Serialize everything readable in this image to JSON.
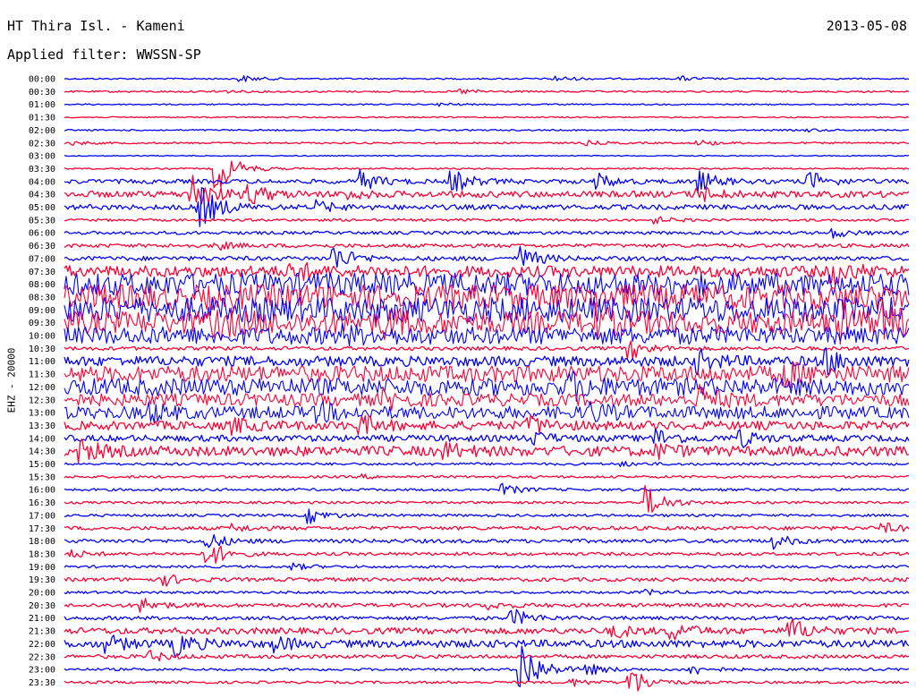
{
  "header": {
    "station": "HT Thira Isl. - Kameni",
    "date": "2013-05-08",
    "filter": "Applied filter: WWSSN-SP"
  },
  "chart_data": {
    "type": "line",
    "title": "HT Thira Isl. - Kameni",
    "subtitle": "Applied filter: WWSSN-SP",
    "ylabel": "EHZ - 20000",
    "xlabel": "",
    "grid": false,
    "trace_colors": [
      "#0000ff",
      "#ff0033"
    ],
    "rows": [
      {
        "label": "00:00",
        "noise": 0.12,
        "events": [
          [
            0.21,
            0.5
          ],
          [
            0.58,
            0.45
          ],
          [
            0.73,
            0.35
          ]
        ]
      },
      {
        "label": "00:30",
        "noise": 0.14,
        "events": [
          [
            0.47,
            0.4
          ],
          [
            0.18,
            0.25
          ]
        ]
      },
      {
        "label": "01:00",
        "noise": 0.1,
        "events": [
          [
            0.44,
            0.3
          ]
        ]
      },
      {
        "label": "01:30",
        "noise": 0.1,
        "events": []
      },
      {
        "label": "02:00",
        "noise": 0.12,
        "events": [
          [
            0.88,
            0.2
          ]
        ]
      },
      {
        "label": "02:30",
        "noise": 0.14,
        "events": [
          [
            0.75,
            0.5
          ],
          [
            0.01,
            0.3
          ],
          [
            0.62,
            0.3
          ]
        ]
      },
      {
        "label": "03:00",
        "noise": 0.08,
        "events": []
      },
      {
        "label": "03:30",
        "noise": 0.12,
        "events": [
          [
            0.18,
            4.0
          ]
        ]
      },
      {
        "label": "04:00",
        "noise": 0.35,
        "events": [
          [
            0.35,
            1.6
          ],
          [
            0.46,
            1.7
          ],
          [
            0.63,
            1.2
          ],
          [
            0.75,
            1.7
          ],
          [
            0.88,
            1.7
          ]
        ]
      },
      {
        "label": "04:30",
        "noise": 0.5,
        "events": [
          [
            0.15,
            3.5
          ],
          [
            0.22,
            1.4
          ],
          [
            0.75,
            1.3
          ],
          [
            0.33,
            0.8
          ]
        ]
      },
      {
        "label": "05:00",
        "noise": 0.4,
        "events": [
          [
            0.16,
            3.5
          ],
          [
            0.3,
            0.8
          ]
        ]
      },
      {
        "label": "05:30",
        "noise": 0.2,
        "events": [
          [
            0.7,
            0.5
          ]
        ]
      },
      {
        "label": "06:00",
        "noise": 0.25,
        "events": [
          [
            0.91,
            0.7
          ]
        ]
      },
      {
        "label": "06:30",
        "noise": 0.3,
        "events": [
          [
            0.18,
            0.6
          ]
        ]
      },
      {
        "label": "07:00",
        "noise": 0.35,
        "events": [
          [
            0.32,
            2.0
          ],
          [
            0.54,
            1.8
          ]
        ]
      },
      {
        "label": "07:30",
        "noise": 0.9,
        "events": [
          [
            0.91,
            1.6
          ],
          [
            0.27,
            1.4
          ]
        ]
      },
      {
        "label": "08:00",
        "noise": 1.8,
        "events": []
      },
      {
        "label": "08:30",
        "noise": 2.0,
        "events": []
      },
      {
        "label": "09:00",
        "noise": 2.0,
        "events": []
      },
      {
        "label": "09:30",
        "noise": 1.8,
        "events": [
          [
            0.18,
            1.5
          ],
          [
            0.38,
            1.5
          ],
          [
            0.63,
            1.5
          ],
          [
            0.92,
            1.8
          ],
          [
            0.97,
            1.8
          ]
        ]
      },
      {
        "label": "10:00",
        "noise": 1.4,
        "events": [
          [
            0.33,
            0.8
          ]
        ]
      },
      {
        "label": "10:30",
        "noise": 0.3,
        "events": [
          [
            0.67,
            1.6
          ]
        ]
      },
      {
        "label": "11:00",
        "noise": 0.8,
        "events": [
          [
            0.75,
            1.5
          ],
          [
            0.9,
            1.8
          ]
        ]
      },
      {
        "label": "11:30",
        "noise": 1.3,
        "events": [
          [
            0.85,
            1.8
          ]
        ]
      },
      {
        "label": "12:00",
        "noise": 1.4,
        "events": [
          [
            0.6,
            1.6
          ]
        ]
      },
      {
        "label": "12:30",
        "noise": 1.0,
        "events": [
          [
            0.75,
            2.0
          ],
          [
            0.38,
            1.0
          ]
        ]
      },
      {
        "label": "13:00",
        "noise": 1.0,
        "events": [
          [
            0.1,
            1.2
          ],
          [
            0.3,
            1.2
          ],
          [
            0.62,
            1.4
          ]
        ]
      },
      {
        "label": "13:30",
        "noise": 0.7,
        "events": [
          [
            0.35,
            1.4
          ],
          [
            0.55,
            1.4
          ],
          [
            0.2,
            1.0
          ]
        ]
      },
      {
        "label": "14:00",
        "noise": 0.5,
        "events": [
          [
            0.55,
            1.2
          ],
          [
            0.7,
            1.4
          ],
          [
            0.8,
            1.2
          ]
        ]
      },
      {
        "label": "14:30",
        "noise": 0.8,
        "events": [
          [
            0.02,
            1.4
          ],
          [
            0.45,
            1.0
          ],
          [
            0.7,
            1.0
          ]
        ]
      },
      {
        "label": "15:00",
        "noise": 0.2,
        "events": [
          [
            0.66,
            0.3
          ]
        ]
      },
      {
        "label": "15:30",
        "noise": 0.2,
        "events": [
          [
            0.35,
            0.3
          ]
        ]
      },
      {
        "label": "16:00",
        "noise": 0.2,
        "events": [
          [
            0.52,
            0.8
          ]
        ]
      },
      {
        "label": "16:30",
        "noise": 0.2,
        "events": [
          [
            0.69,
            2.6
          ]
        ]
      },
      {
        "label": "17:00",
        "noise": 0.2,
        "events": [
          [
            0.29,
            1.2
          ]
        ]
      },
      {
        "label": "17:30",
        "noise": 0.3,
        "events": [
          [
            0.2,
            0.5
          ],
          [
            0.97,
            0.7
          ]
        ]
      },
      {
        "label": "18:00",
        "noise": 0.3,
        "events": [
          [
            0.84,
            1.0
          ],
          [
            0.17,
            1.2
          ]
        ]
      },
      {
        "label": "18:30",
        "noise": 0.25,
        "events": [
          [
            0.17,
            2.2
          ],
          [
            0.01,
            0.5
          ]
        ]
      },
      {
        "label": "19:00",
        "noise": 0.2,
        "events": [
          [
            0.27,
            0.5
          ]
        ]
      },
      {
        "label": "19:30",
        "noise": 0.3,
        "events": [
          [
            0.12,
            0.8
          ]
        ]
      },
      {
        "label": "20:00",
        "noise": 0.2,
        "events": [
          [
            0.69,
            0.4
          ]
        ]
      },
      {
        "label": "20:30",
        "noise": 0.3,
        "events": [
          [
            0.09,
            1.2
          ],
          [
            0.5,
            0.6
          ]
        ]
      },
      {
        "label": "21:00",
        "noise": 0.3,
        "events": [
          [
            0.53,
            1.4
          ]
        ]
      },
      {
        "label": "21:30",
        "noise": 0.5,
        "events": [
          [
            0.72,
            1.3
          ],
          [
            0.86,
            1.8
          ],
          [
            0.65,
            1.0
          ]
        ]
      },
      {
        "label": "22:00",
        "noise": 0.6,
        "events": [
          [
            0.13,
            1.8
          ],
          [
            0.05,
            1.2
          ],
          [
            0.25,
            1.0
          ]
        ]
      },
      {
        "label": "22:30",
        "noise": 0.3,
        "events": [
          [
            0.1,
            0.8
          ]
        ]
      },
      {
        "label": "23:00",
        "noise": 0.2,
        "events": [
          [
            0.54,
            5.0
          ],
          [
            0.74,
            1.0
          ],
          [
            0.62,
            0.8
          ]
        ]
      },
      {
        "label": "23:30",
        "noise": 0.2,
        "events": [
          [
            0.67,
            2.5
          ],
          [
            0.6,
            0.6
          ]
        ]
      }
    ]
  }
}
